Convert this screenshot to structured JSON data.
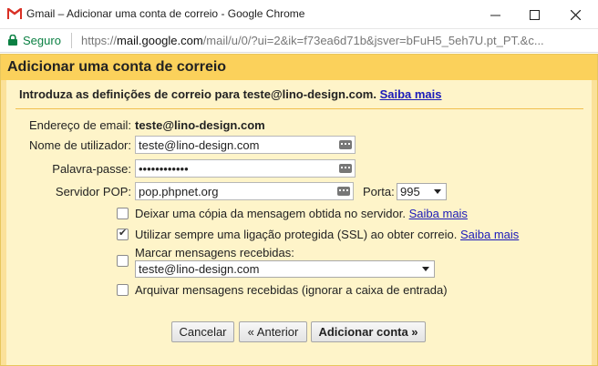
{
  "window": {
    "title": "Gmail – Adicionar uma conta de correio - Google Chrome"
  },
  "addressbar": {
    "secure_label": "Seguro",
    "url_scheme": "https://",
    "url_host": "mail.google.com",
    "url_rest": "/mail/u/0/?ui=2&ik=f73ea6d71b&jsver=bFuH5_5eh7U.pt_PT.&c..."
  },
  "dialog": {
    "heading": "Adicionar uma conta de correio",
    "intro_text": "Introduza as definições de correio para teste@lino-design.com.",
    "intro_link": "Saiba mais",
    "email_label": "Endereço de email:",
    "email_value": "teste@lino-design.com",
    "username_label": "Nome de utilizador:",
    "username_value": "teste@lino-design.com",
    "password_label": "Palavra-passe:",
    "password_value": "••••••••••••",
    "pop_label": "Servidor POP:",
    "pop_value": "pop.phpnet.org",
    "port_label": "Porta:",
    "port_value": "995",
    "options": {
      "leave_copy": {
        "text": "Deixar uma cópia da mensagem obtida no servidor.",
        "link": "Saiba mais",
        "checked": false
      },
      "use_ssl": {
        "text": "Utilizar sempre uma ligação protegida (SSL) ao obter correio.",
        "link": "Saiba mais",
        "checked": true
      },
      "label_incoming": {
        "text": "Marcar mensagens recebidas:",
        "select_value": "teste@lino-design.com",
        "checked": false
      },
      "archive_incoming": {
        "text": "Arquivar mensagens recebidas (ignorar a caixa de entrada)",
        "checked": false
      }
    },
    "buttons": {
      "cancel": "Cancelar",
      "back": "« Anterior",
      "add": "Adicionar conta »"
    }
  },
  "colors": {
    "header_bg": "#fbd15b",
    "body_bg": "#fef4c9",
    "link": "#1a1ab9",
    "secure_green": "#0b8043"
  },
  "icons": [
    "gmail-icon",
    "lock-icon",
    "minimize-icon",
    "maximize-icon",
    "close-icon",
    "keyboard-icon",
    "dropdown-caret-icon",
    "checkmark-icon"
  ]
}
